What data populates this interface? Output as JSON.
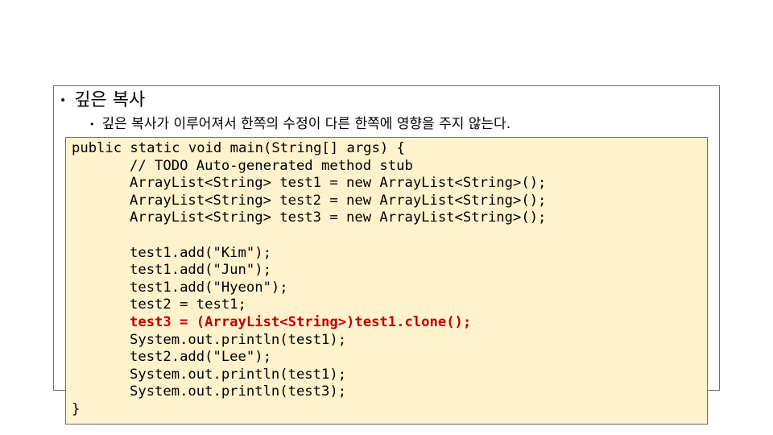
{
  "slide": {
    "heading": "깊은 복사",
    "subbullet": "깊은 복사가 이루어져서 한쪽의 수정이 다른 한쪽에 영향을 주지 않는다.",
    "bullet_glyph": "•"
  },
  "code": {
    "lines": [
      {
        "indent": 0,
        "text": "public static void main(String[] args) {"
      },
      {
        "indent": 1,
        "text": "// TODO Auto-generated method stub"
      },
      {
        "indent": 1,
        "text": "ArrayList<String> test1 = new ArrayList<String>();"
      },
      {
        "indent": 1,
        "text": "ArrayList<String> test2 = new ArrayList<String>();"
      },
      {
        "indent": 1,
        "text": "ArrayList<String> test3 = new ArrayList<String>();"
      },
      {
        "indent": 0,
        "text": ""
      },
      {
        "indent": 1,
        "text": "test1.add(\"Kim\");"
      },
      {
        "indent": 1,
        "text": "test1.add(\"Jun\");"
      },
      {
        "indent": 1,
        "text": "test1.add(\"Hyeon\");"
      },
      {
        "indent": 1,
        "text": "test2 = test1;"
      },
      {
        "indent": 1,
        "text": "test3 = (ArrayList<String>)test1.clone();"
      },
      {
        "indent": 1,
        "text": "System.out.println(test1);"
      },
      {
        "indent": 1,
        "text": "test2.add(\"Lee\");"
      },
      {
        "indent": 1,
        "text": "System.out.println(test1);"
      },
      {
        "indent": 1,
        "text": "System.out.println(test3);"
      },
      {
        "indent": 0,
        "text": "}"
      }
    ],
    "highlight_line": 10,
    "highlight_color": "#c00000",
    "background_color": "#fff2cc"
  }
}
